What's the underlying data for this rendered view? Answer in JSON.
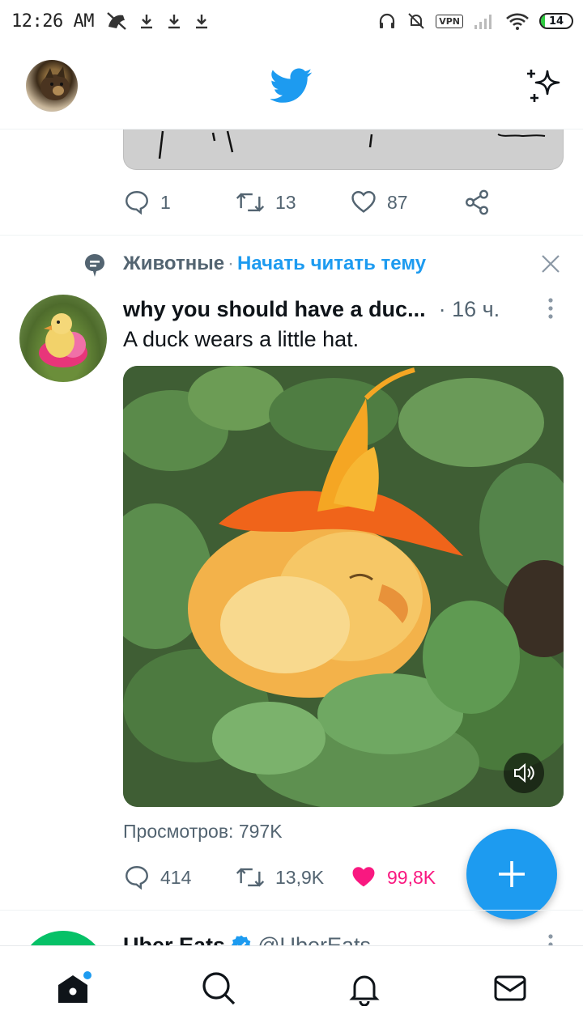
{
  "status_bar": {
    "time": "12:26 AM",
    "vpn": "VPN",
    "battery": "14",
    "battery_level_pct": 14
  },
  "header": {
    "avatar": "user-avatar",
    "logo": "twitter-bird-icon",
    "timeline_icon": "sparkle-icon"
  },
  "prev_tweet": {
    "replies": "1",
    "retweets": "13",
    "likes": "87"
  },
  "topic": {
    "label": "Животные",
    "separator": "·",
    "follow_label": "Начать читать тему"
  },
  "tweet": {
    "author": "why you should have a duc...",
    "time": "· 16 ч.",
    "text": "A duck wears a little hat.",
    "views": "Просмотров: 797K",
    "replies": "414",
    "retweets": "13,9K",
    "likes": "99,8K",
    "liked": true
  },
  "next_tweet": {
    "author": "Uber Eats",
    "handle": "@UberEats",
    "verified": true
  },
  "colors": {
    "accent": "#1d9bf0",
    "like": "#f91880",
    "muted": "#536471"
  },
  "bottom_nav": [
    "home-icon",
    "search-icon",
    "notifications-icon",
    "messages-icon"
  ]
}
